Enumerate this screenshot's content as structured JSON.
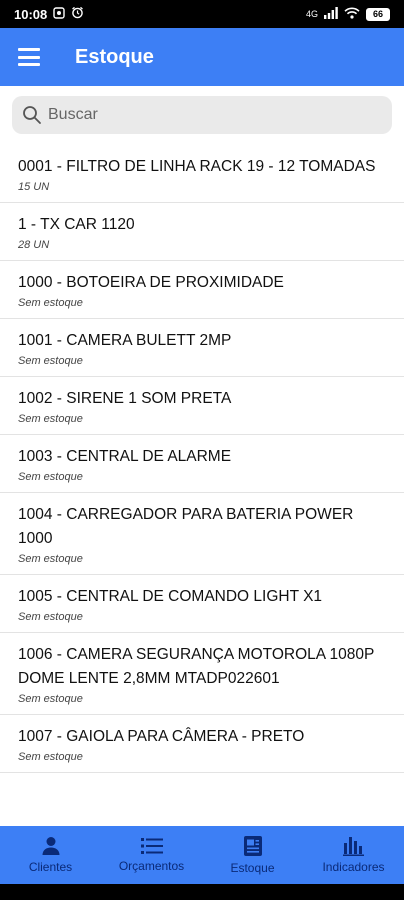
{
  "status_bar": {
    "time": "10:08",
    "network": "4G",
    "battery": "66"
  },
  "app_bar": {
    "title": "Estoque"
  },
  "search": {
    "placeholder": "Buscar"
  },
  "items": [
    {
      "title": "0001 - FILTRO DE LINHA RACK 19 - 12 TOMADAS",
      "stock": "15 UN"
    },
    {
      "title": "1 - TX CAR 1120",
      "stock": "28 UN"
    },
    {
      "title": "1000 - BOTOEIRA DE PROXIMIDADE",
      "stock": "Sem estoque"
    },
    {
      "title": "1001 - CAMERA BULETT 2MP",
      "stock": "Sem estoque"
    },
    {
      "title": "1002 - SIRENE 1 SOM PRETA",
      "stock": "Sem estoque"
    },
    {
      "title": "1003 - CENTRAL DE ALARME",
      "stock": "Sem estoque"
    },
    {
      "title": "1004 - CARREGADOR PARA BATERIA POWER 1000",
      "stock": "Sem estoque"
    },
    {
      "title": "1005 - CENTRAL DE COMANDO LIGHT X1",
      "stock": "Sem estoque"
    },
    {
      "title": "1006 - CAMERA SEGURANÇA MOTOROLA 1080P DOME LENTE 2,8MM MTADP022601",
      "stock": "Sem estoque"
    },
    {
      "title": "1007 - GAIOLA PARA CÂMERA - PRETO",
      "stock": "Sem estoque"
    }
  ],
  "bottom_nav": [
    {
      "label": "Clientes",
      "icon": "person-icon"
    },
    {
      "label": "Orçamentos",
      "icon": "list-icon"
    },
    {
      "label": "Estoque",
      "icon": "document-icon"
    },
    {
      "label": "Indicadores",
      "icon": "bar-chart-icon"
    }
  ],
  "colors": {
    "primary": "#3d7ff5",
    "nav_text": "#0a2a78"
  }
}
